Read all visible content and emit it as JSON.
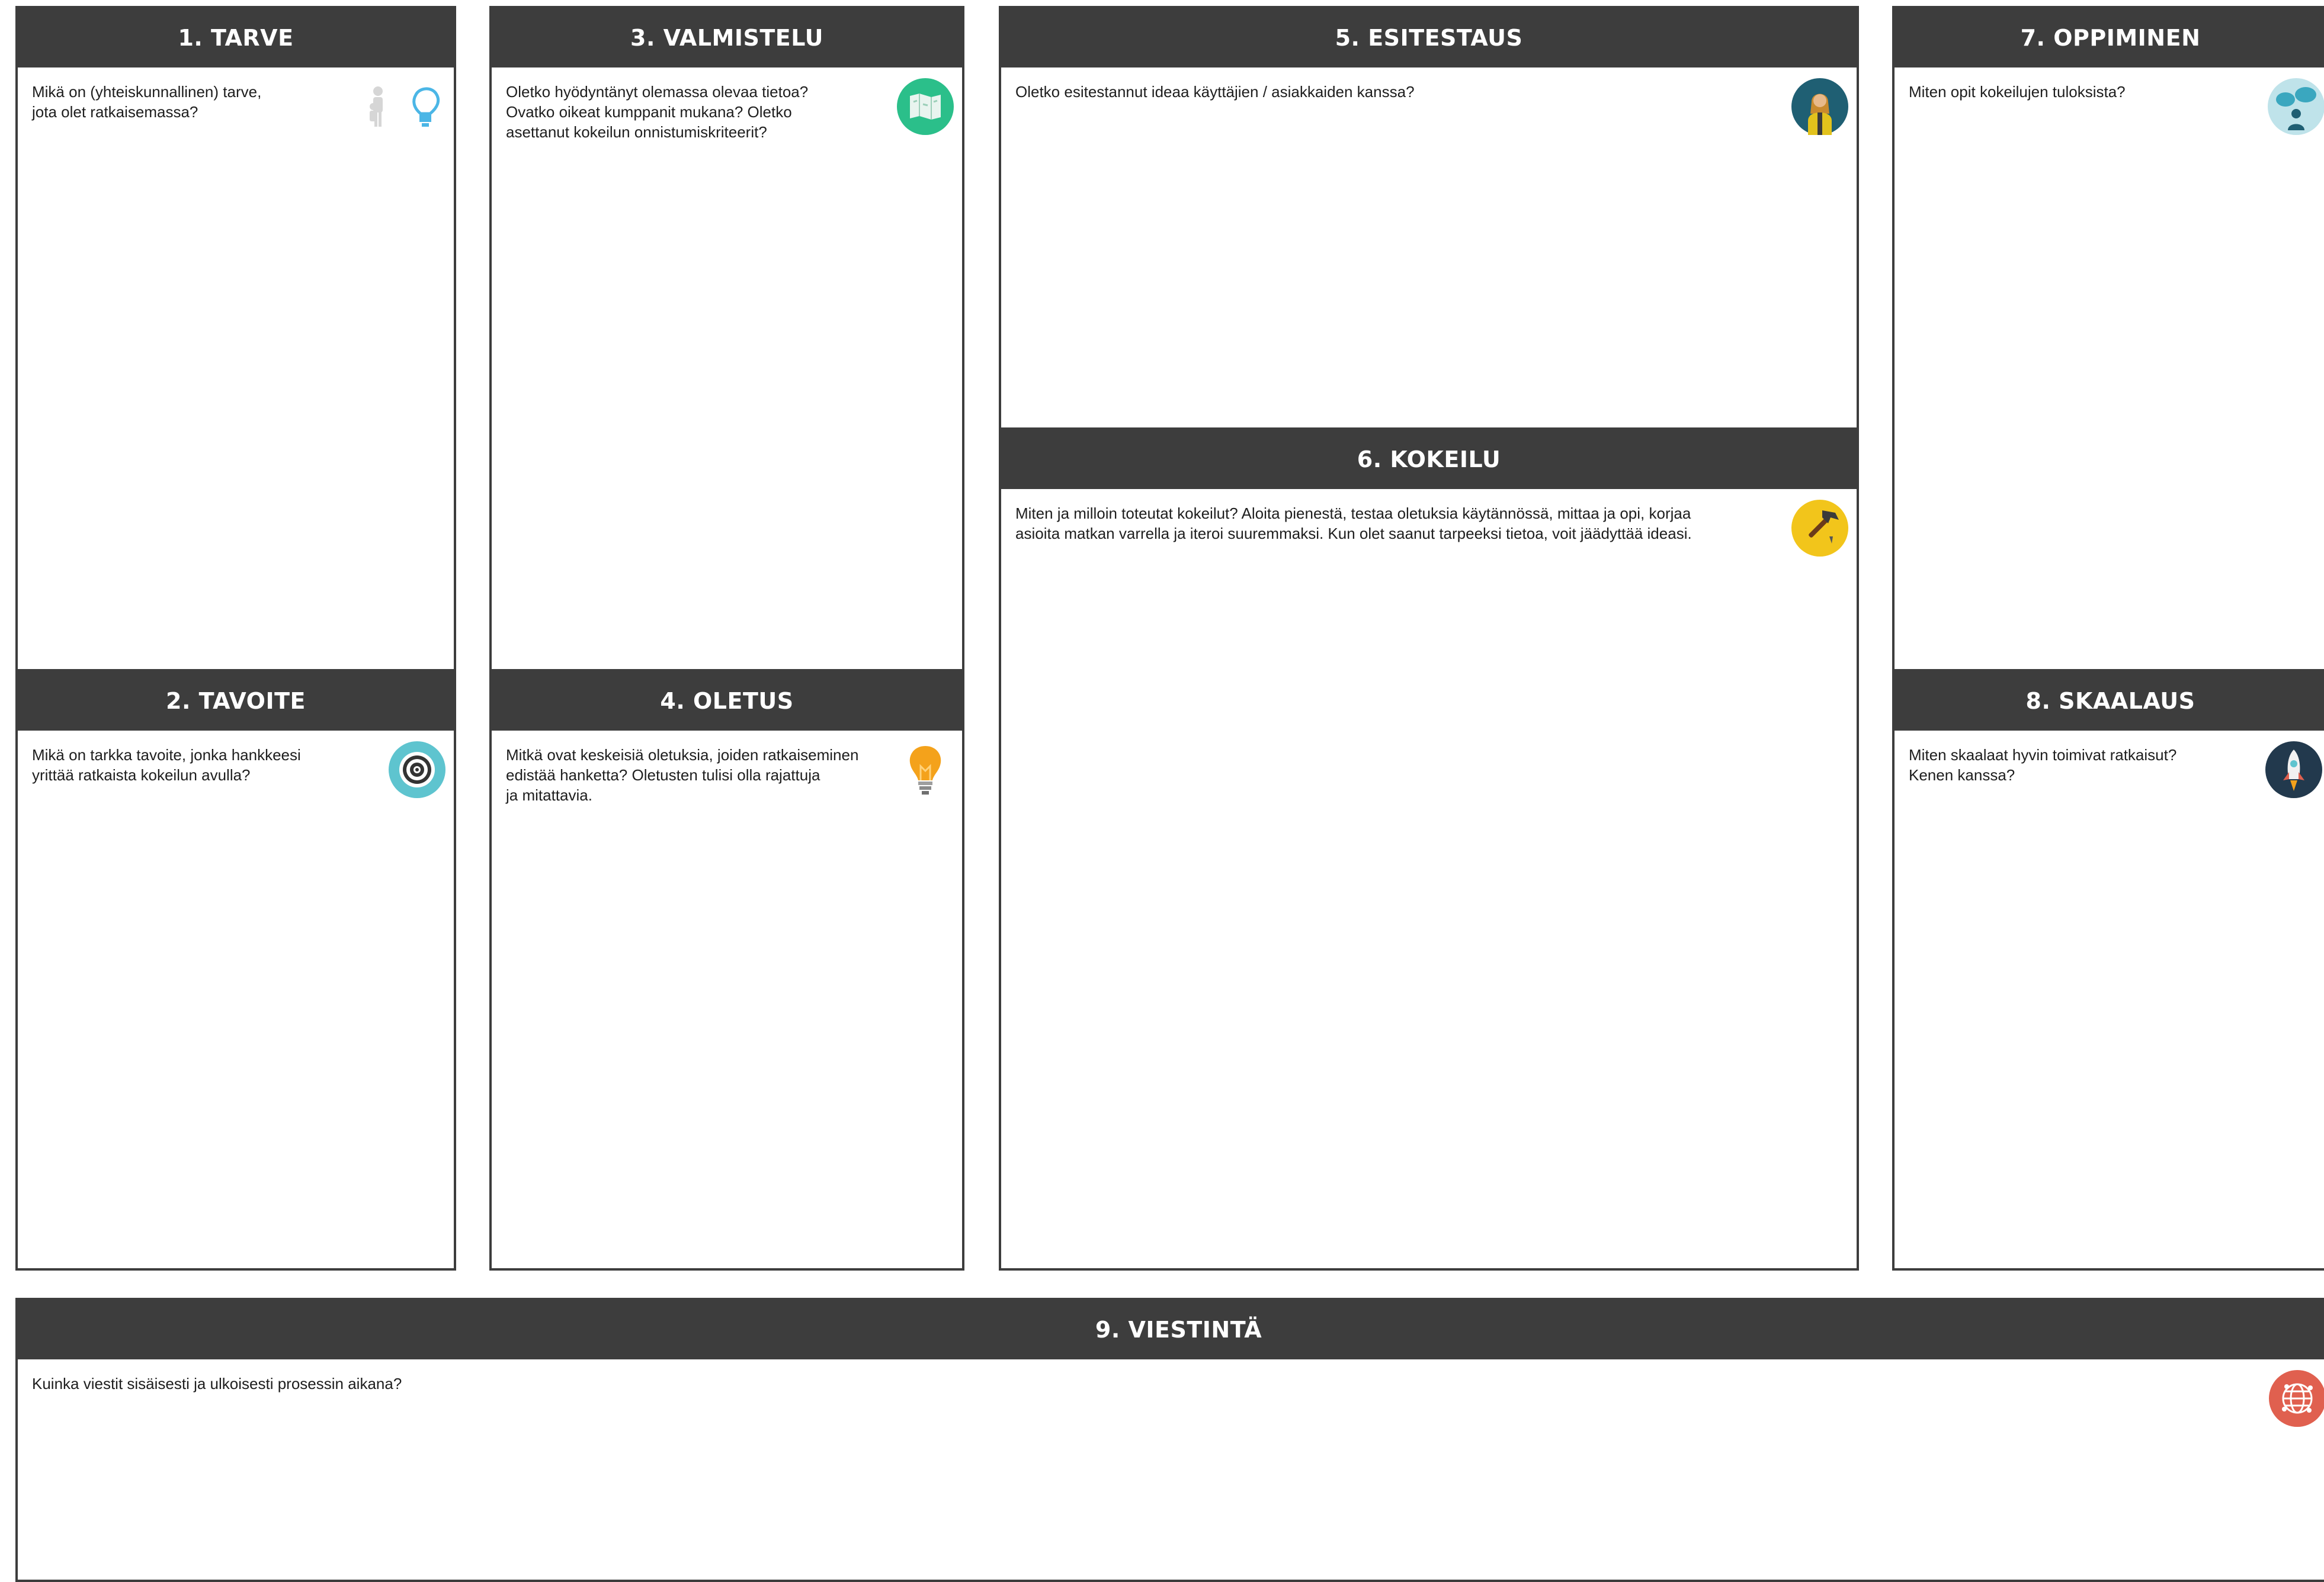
{
  "cards": {
    "tarve": {
      "title": "1. TARVE",
      "question": "Mikä on (yhteiskunnallinen) tarve,\njota olet ratkaisemassa?",
      "icon": "people-lightbulb-icon"
    },
    "tavoite": {
      "title": "2. TAVOITE",
      "question": "Mikä on tarkka tavoite, jonka hankkeesi\nyrittää ratkaista kokeilun avulla?",
      "icon": "target-icon"
    },
    "valmistelu": {
      "title": "3. VALMISTELU",
      "question": "Oletko hyödyntänyt olemassa olevaa tietoa?\nOvatko oikeat kumppanit mukana? Oletko\nasettanut kokeilun onnistumiskriteerit?",
      "icon": "map-icon"
    },
    "oletus": {
      "title": "4. OLETUS",
      "question": "Mitkä ovat keskeisiä oletuksia, joiden ratkaiseminen\nedistää hanketta? Oletusten tulisi olla rajattuja\nja mitattavia.",
      "icon": "lightbulb-icon"
    },
    "esitestaus": {
      "title": "5. ESITESTAUS",
      "question": "Oletko esitestannut ideaa käyttäjien / asiakkaiden kanssa?",
      "icon": "person-icon"
    },
    "kokeilu": {
      "title": "6. KOKEILU",
      "question": "Miten ja milloin toteutat kokeilut? Aloita pienestä, testaa oletuksia käytännössä, mittaa ja opi, korjaa\nasioita matkan varrella ja iteroi suuremmaksi. Kun olet saanut tarpeeksi tietoa, voit jäädyttää ideasi.",
      "icon": "hammer-icon"
    },
    "oppiminen": {
      "title": "7. OPPIMINEN",
      "question": "Miten opit kokeilujen tuloksista?",
      "icon": "speech-bubbles-icon"
    },
    "skaalaus": {
      "title": "8. SKAALAUS",
      "question": "Miten skaalaat hyvin toimivat ratkaisut?\nKenen kanssa?",
      "icon": "rocket-icon"
    },
    "viestinta": {
      "title": "9. VIESTINTÄ",
      "question": "Kuinka viestit sisäisesti ja ulkoisesti prosessin aikana?",
      "icon": "globe-icon"
    }
  },
  "colors": {
    "header": "#3d3d3d",
    "border": "#3d3d3d",
    "map": "#2bbf8a",
    "target": "#5ec4cf",
    "bulb": "#f4a21b",
    "person": "#1f5f73",
    "hammer": "#f2c51b",
    "bubbles": "#bfe3ea",
    "rocket": "#22394d",
    "globe": "#e0604f"
  }
}
